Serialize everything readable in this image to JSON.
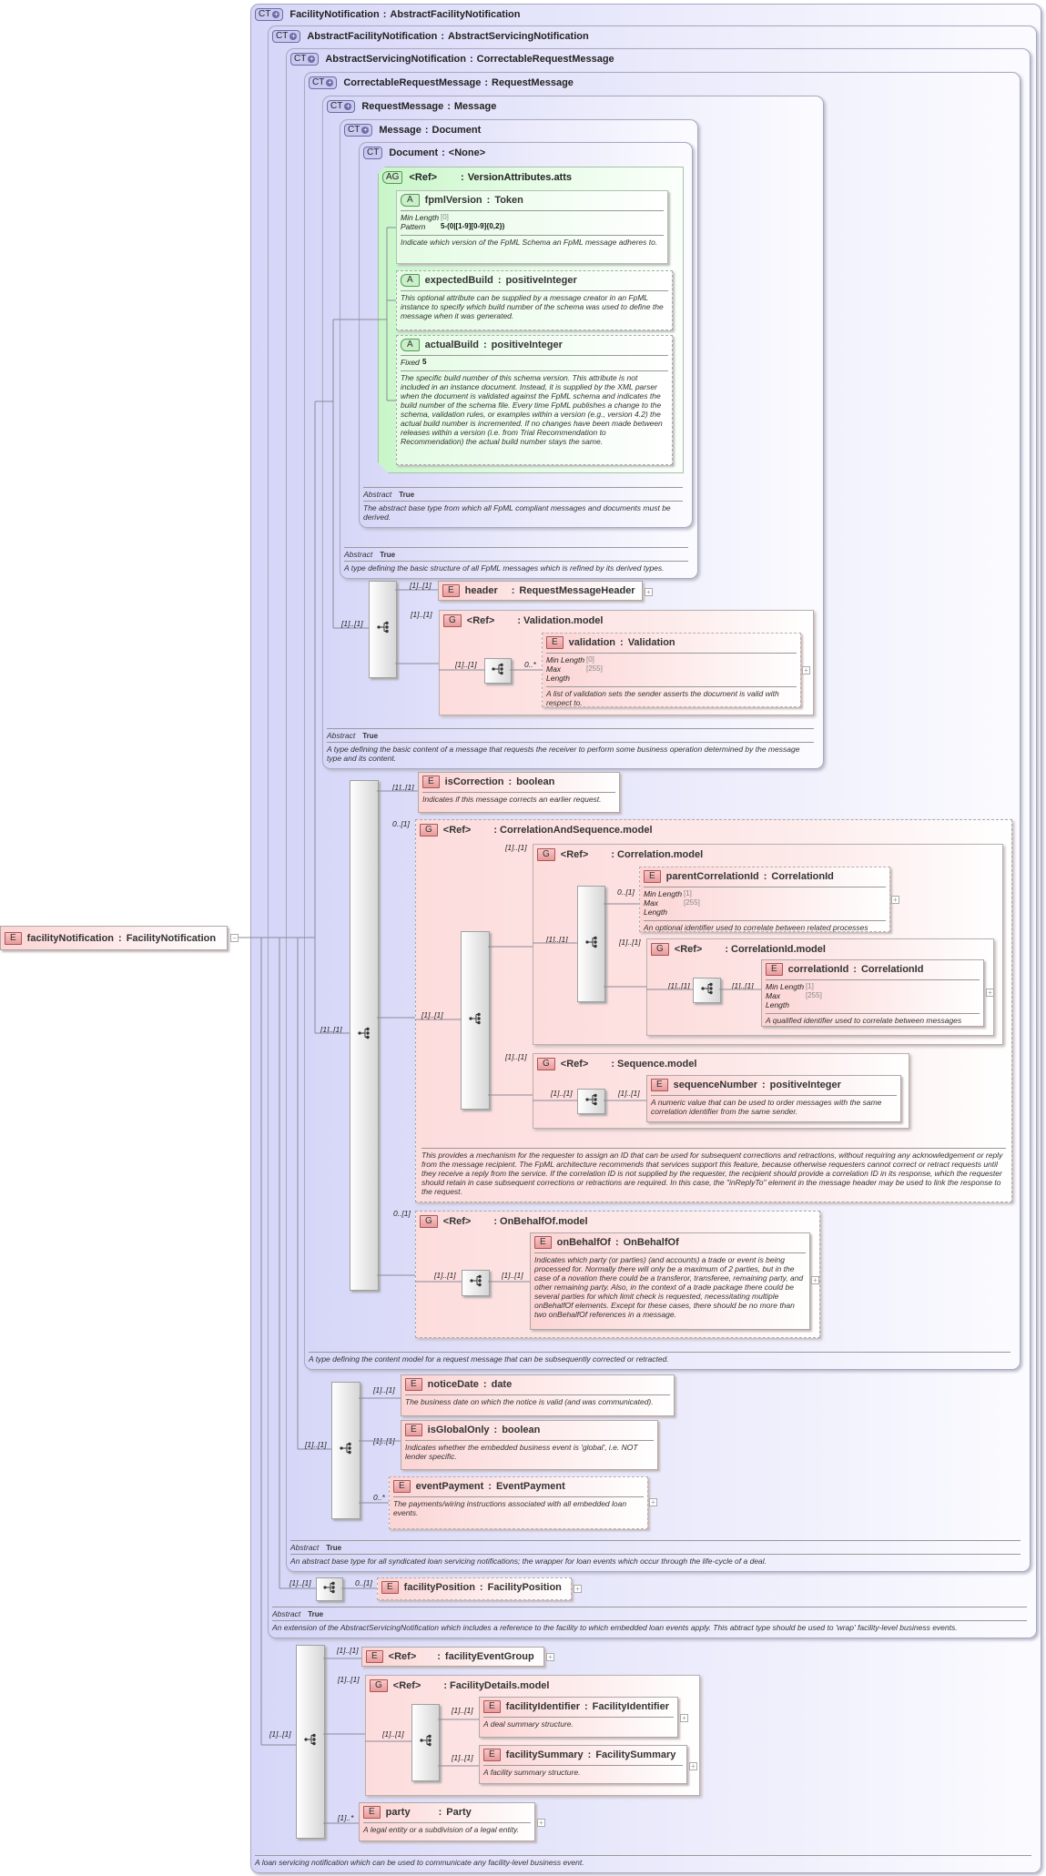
{
  "labels": {
    "sep": ":",
    "ref": "<Ref>",
    "abstract": "Abstract",
    "min_length": "Min Length",
    "max_length": "Max Length",
    "pattern": "Pattern",
    "fixed": "Fixed",
    "expand": "+",
    "collapse": "−"
  },
  "types": {
    "facility_notification": {
      "badge": "CT",
      "name": "FacilityNotification",
      "base": "AbstractFacilityNotification",
      "description": "A loan servicing notification which can be used to communicate any facility-level business event."
    },
    "abstract_facility_notification": {
      "badge": "CT",
      "name": "AbstractFacilityNotification",
      "base": "AbstractServicingNotification",
      "abstract": "True",
      "description": "An extension of the AbstractServicingNotification which includes a reference to the facility to which embedded loan events apply. This abtract type should be used to 'wrap' facility-level business events."
    },
    "abstract_servicing_notification": {
      "badge": "CT",
      "name": "AbstractServicingNotification",
      "base": "CorrectableRequestMessage",
      "abstract": "True",
      "description": "An abstract base type for all syndicated loan servicing notifications; the wrapper for loan events which occur through the life-cycle of a deal."
    },
    "correctable_request_message": {
      "badge": "CT",
      "name": "CorrectableRequestMessage",
      "base": "RequestMessage",
      "description": "A type defining the content model for a request message that can be subsequently corrected or retracted."
    },
    "request_message": {
      "badge": "CT",
      "name": "RequestMessage",
      "base": "Message",
      "abstract": "True",
      "description": "A type defining the basic content of a message that requests the receiver to perform some business operation determined by the message type and its content."
    },
    "message": {
      "badge": "CT",
      "name": "Message",
      "base": "Document",
      "abstract": "True",
      "description": "A type defining the basic structure of all FpML messages which is refined by its derived types."
    },
    "document": {
      "badge": "CT",
      "name": "Document",
      "base": "<None>",
      "abstract": "True",
      "description": "The abstract base type from which all FpML compliant messages and documents must be derived."
    }
  },
  "attribute_group": {
    "badge": "AG",
    "name": "VersionAttributes.atts"
  },
  "attributes": {
    "fpml_version": {
      "badge": "A",
      "name": "fpmlVersion",
      "type": "Token",
      "min_length": "[0]",
      "pattern": "5-(0|[1-9][0-9]{0,2})",
      "description": "Indicate which version of the FpML Schema an FpML message adheres to."
    },
    "expected_build": {
      "badge": "A",
      "name": "expectedBuild",
      "type": "positiveInteger",
      "description": "This optional attribute can be supplied by a message creator in an FpML instance to specify which build number of the schema was used to define the message when it was generated."
    },
    "actual_build": {
      "badge": "A",
      "name": "actualBuild",
      "type": "positiveInteger",
      "fixed": "5",
      "description": "The specific build number of this schema version. This attribute is not included in an instance document. Instead, it is supplied by the XML parser when the document is validated against the FpML schema and indicates the build number of the schema file. Every time FpML publishes a change to the schema, validation rules, or examples within a version (e.g., version 4.2) the actual build number is incremented. If no changes have been made between releases within a version (i.e. from Trial Recommendation to Recommendation) the actual build number stays the same."
    }
  },
  "groups": {
    "validation_model": {
      "badge": "G",
      "name": "Validation.model"
    },
    "correlation_and_sequence_model": {
      "badge": "G",
      "name": "CorrelationAndSequence.model",
      "description": "This provides a mechanism for the requester to assign an ID that can be used for subsequent corrections and retractions, without requiring any acknowledgement or reply from the message recipient. The FpML architecture recommends that services support this feature, because otherwise requesters cannot correct or retract requests until they receive a reply from the service. If the correlation ID is not supplied by the requester, the recipient should provide a correlation ID in its response, which the requester should retain in case subsequent corrections or retractions are required. In this case, the \"inReplyTo\" element in the message header may be used to link the response to the request."
    },
    "correlation_model": {
      "badge": "G",
      "name": "Correlation.model"
    },
    "correlation_id_model": {
      "badge": "G",
      "name": "CorrelationId.model"
    },
    "sequence_model": {
      "badge": "G",
      "name": "Sequence.model"
    },
    "on_behalf_of_model": {
      "badge": "G",
      "name": "OnBehalfOf.model"
    },
    "facility_details_model": {
      "badge": "G",
      "name": "FacilityDetails.model"
    }
  },
  "elements": {
    "root": {
      "badge": "E",
      "name": "facilityNotification",
      "type": "FacilityNotification"
    },
    "header": {
      "badge": "E",
      "name": "header",
      "type": "RequestMessageHeader"
    },
    "validation": {
      "badge": "E",
      "name": "validation",
      "type": "Validation",
      "min_length": "[0]",
      "max_length": "[255]",
      "description": "A list of validation sets the sender asserts the document is valid with respect to."
    },
    "is_correction": {
      "badge": "E",
      "name": "isCorrection",
      "type": "boolean",
      "description": "Indicates if this message corrects an earlier request."
    },
    "parent_correlation_id": {
      "badge": "E",
      "name": "parentCorrelationId",
      "type": "CorrelationId",
      "min_length": "[1]",
      "max_length": "[255]",
      "description": "An optional identifier used to correlate between related processes"
    },
    "correlation_id": {
      "badge": "E",
      "name": "correlationId",
      "type": "CorrelationId",
      "min_length": "[1]",
      "max_length": "[255]",
      "description": "A qualified identifier used to correlate between messages"
    },
    "sequence_number": {
      "badge": "E",
      "name": "sequenceNumber",
      "type": "positiveInteger",
      "description": "A numeric value that can be used to order messages with the same correlation identifier from the same sender."
    },
    "on_behalf_of": {
      "badge": "E",
      "name": "onBehalfOf",
      "type": "OnBehalfOf",
      "description": "Indicates which party (or parties) (and accounts) a trade or event is being processed for. Normally there will only be a maximum of 2 parties, but in the case of a novation there could be a transferor, transferee, remaining party, and other remaining party. Also, in the context of a trade package there could be several parties for which limit check is requested, necessitating multiple onBehalfOf elements. Except for these cases, there should be no more than two onBehalfOf references in a message."
    },
    "notice_date": {
      "badge": "E",
      "name": "noticeDate",
      "type": "date",
      "description": "The business date on which the notice is valid (and was communicated)."
    },
    "is_global_only": {
      "badge": "E",
      "name": "isGlobalOnly",
      "type": "boolean",
      "description": "Indicates whether the embedded business event is 'global', i.e. NOT lender specific."
    },
    "event_payment": {
      "badge": "E",
      "name": "eventPayment",
      "type": "EventPayment",
      "description": "The payments/wiring instructions associated with all embedded loan events."
    },
    "facility_position": {
      "badge": "E",
      "name": "facilityPosition",
      "type": "FacilityPosition"
    },
    "facility_event_group": {
      "badge": "E",
      "name": "facilityEventGroup"
    },
    "facility_identifier": {
      "badge": "E",
      "name": "facilityIdentifier",
      "type": "FacilityIdentifier",
      "description": "A deal summary structure."
    },
    "facility_summary": {
      "badge": "E",
      "name": "facilitySummary",
      "type": "FacilitySummary",
      "description": "A facility summary structure."
    },
    "party": {
      "badge": "E",
      "name": "party",
      "type": "Party",
      "description": "A legal entity or a subdivision of a legal entity."
    }
  },
  "card": {
    "one": "[1]..[1]",
    "opt": "0..[1]",
    "many": "0..*",
    "one_many": "[1]..*"
  }
}
